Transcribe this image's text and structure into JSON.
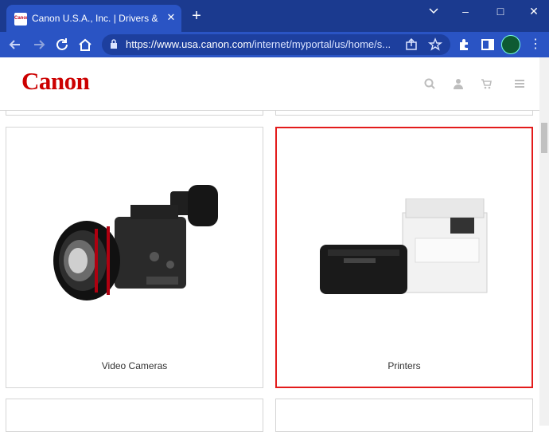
{
  "browser": {
    "tab_title": "Canon U.S.A., Inc. | Drivers & Downloads",
    "favicon_text": "Canon",
    "close_tab": "✕",
    "new_tab": "+",
    "url_host": "https://www.usa.canon.com",
    "url_path": "/internet/myportal/us/home/s...",
    "win_min": "–",
    "win_max": "□",
    "win_close": "✕",
    "menu": "⋮"
  },
  "site": {
    "logo": "Canon",
    "icons": [
      "search-icon",
      "user-icon",
      "cart-icon",
      "hamburger-menu-icon"
    ]
  },
  "products": [
    {
      "label": "Video Cameras",
      "selected": false
    },
    {
      "label": "Printers",
      "selected": true
    }
  ],
  "colors": {
    "brand": "#cc0000",
    "selection": "#e31b1b",
    "tabstrip": "#1b3a8f",
    "toolbar": "#2a54c4"
  }
}
